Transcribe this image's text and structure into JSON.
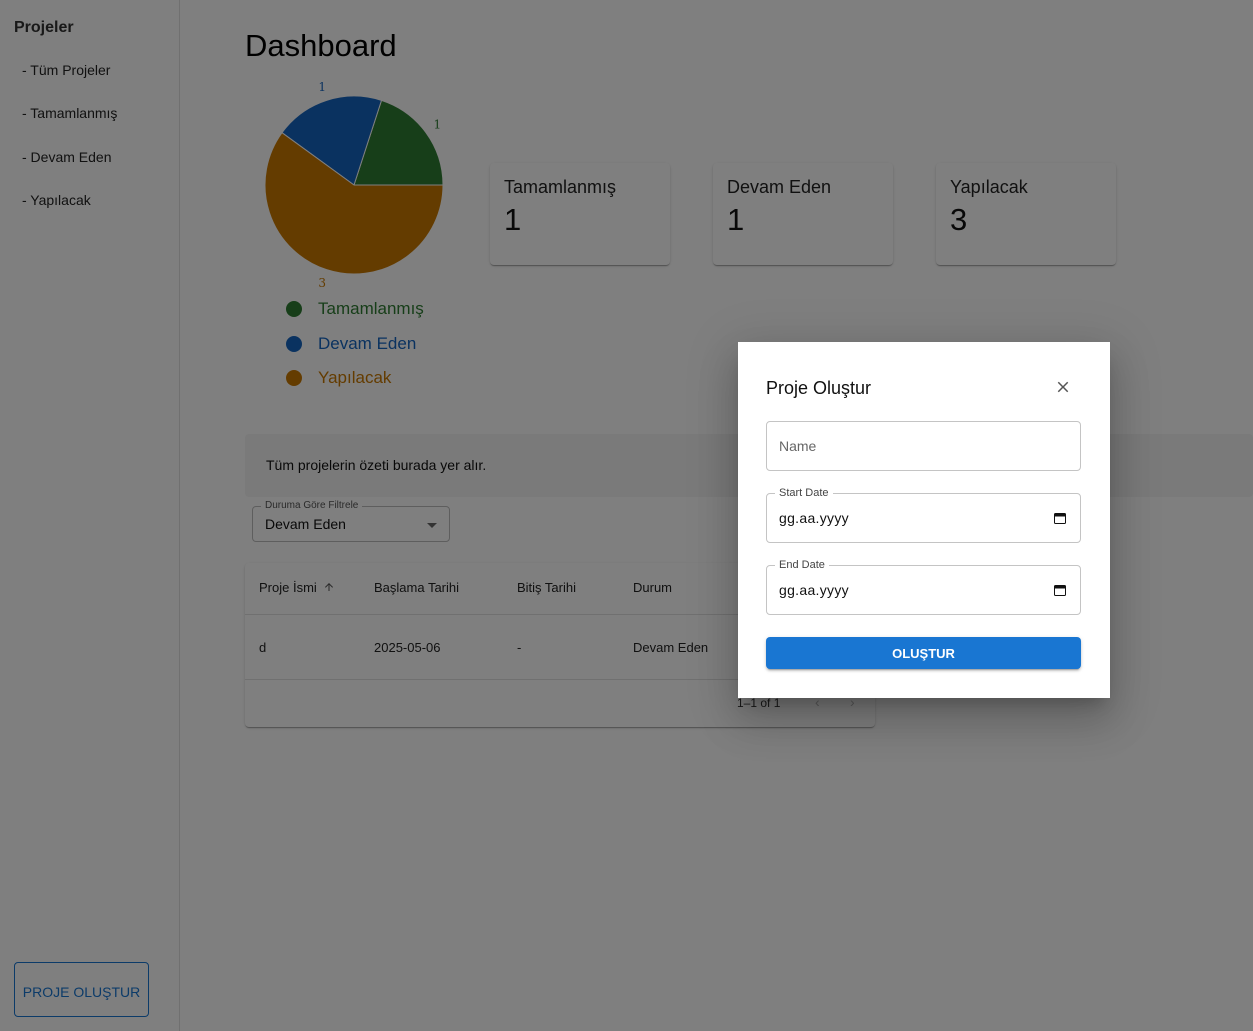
{
  "sidebar": {
    "title": "Projeler",
    "items": [
      {
        "label": "- Tüm Projeler"
      },
      {
        "label": "- Tamamlanmış"
      },
      {
        "label": "- Devam Eden"
      },
      {
        "label": "- Yapılacak"
      }
    ],
    "create_button": "PROJE OLUŞTUR"
  },
  "main": {
    "title": "Dashboard",
    "stats": [
      {
        "label": "Tamamlanmış",
        "value": "1"
      },
      {
        "label": "Devam Eden",
        "value": "1"
      },
      {
        "label": "Yapılacak",
        "value": "3"
      }
    ],
    "info_text": "Tüm projelerin özeti burada yer alır.",
    "filter": {
      "label": "Duruma Göre Filtrele",
      "value": "Devam Eden"
    },
    "table": {
      "columns": [
        "Proje İsmi",
        "Başlama Tarihi",
        "Bitiş Tarihi",
        "Durum"
      ],
      "rows": [
        [
          "d",
          "2025-05-06",
          "-",
          "Devam Eden"
        ]
      ],
      "pagination": "1–1 of 1"
    }
  },
  "chart_data": {
    "type": "pie",
    "categories": [
      "Tamamlanmış",
      "Devam Eden",
      "Yapılacak"
    ],
    "values": [
      1,
      1,
      3
    ],
    "colors": [
      "#2e7d32",
      "#1565c0",
      "#c97800"
    ],
    "legend": "bottom"
  },
  "modal": {
    "title": "Proje Oluştur",
    "name_placeholder": "Name",
    "start_label": "Start Date",
    "start_value": "gg.aa.yyyy",
    "end_label": "End Date",
    "end_value": "gg.aa.yyyy",
    "submit": "OLUŞTUR"
  }
}
